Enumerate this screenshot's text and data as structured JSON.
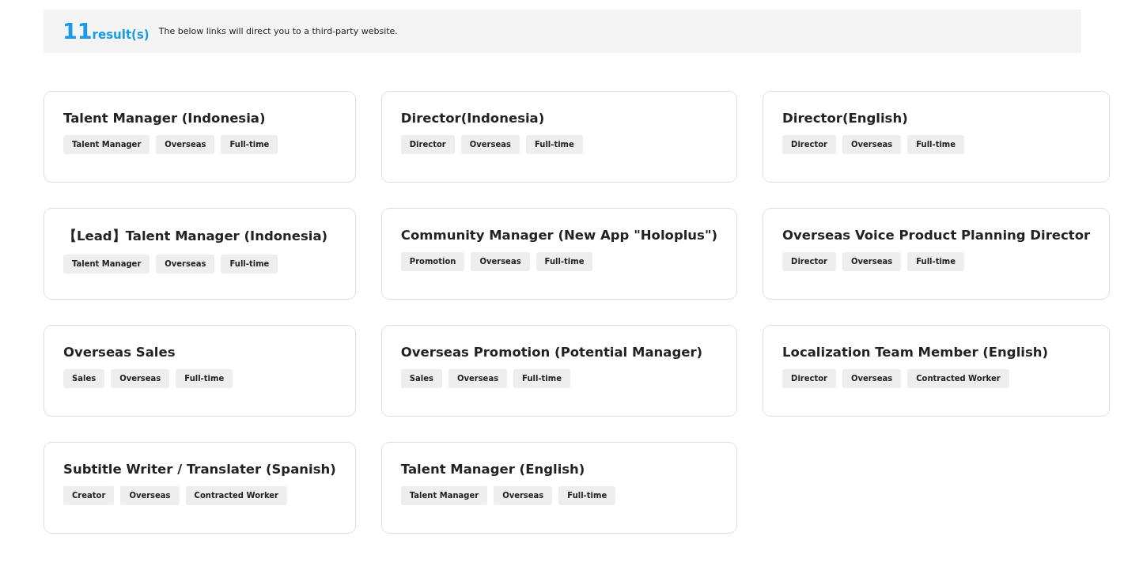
{
  "summary": {
    "count": "11",
    "unit": "result(s)",
    "note": "The below links will direct you to a third-party website."
  },
  "jobs": [
    {
      "title": "Talent Manager (Indonesia)",
      "tags": [
        "Talent Manager",
        "Overseas",
        "Full-time"
      ]
    },
    {
      "title": "Director(Indonesia)",
      "tags": [
        "Director",
        "Overseas",
        "Full-time"
      ]
    },
    {
      "title": "Director(English)",
      "tags": [
        "Director",
        "Overseas",
        "Full-time"
      ]
    },
    {
      "title": "【Lead】Talent Manager (Indonesia)",
      "tags": [
        "Talent Manager",
        "Overseas",
        "Full-time"
      ]
    },
    {
      "title": "Community Manager (New App \"Holoplus\")",
      "tags": [
        "Promotion",
        "Overseas",
        "Full-time"
      ]
    },
    {
      "title": "Overseas Voice Product Planning Director",
      "tags": [
        "Director",
        "Overseas",
        "Full-time"
      ]
    },
    {
      "title": "Overseas Sales",
      "tags": [
        "Sales",
        "Overseas",
        "Full-time"
      ]
    },
    {
      "title": "Overseas Promotion (Potential Manager)",
      "tags": [
        "Sales",
        "Overseas",
        "Full-time"
      ]
    },
    {
      "title": "Localization Team Member (English)",
      "tags": [
        "Director",
        "Overseas",
        "Contracted Worker"
      ]
    },
    {
      "title": "Subtitle Writer / Translater (Spanish)",
      "tags": [
        "Creator",
        "Overseas",
        "Contracted Worker"
      ]
    },
    {
      "title": "Talent Manager (English)",
      "tags": [
        "Talent Manager",
        "Overseas",
        "Full-time"
      ]
    }
  ]
}
